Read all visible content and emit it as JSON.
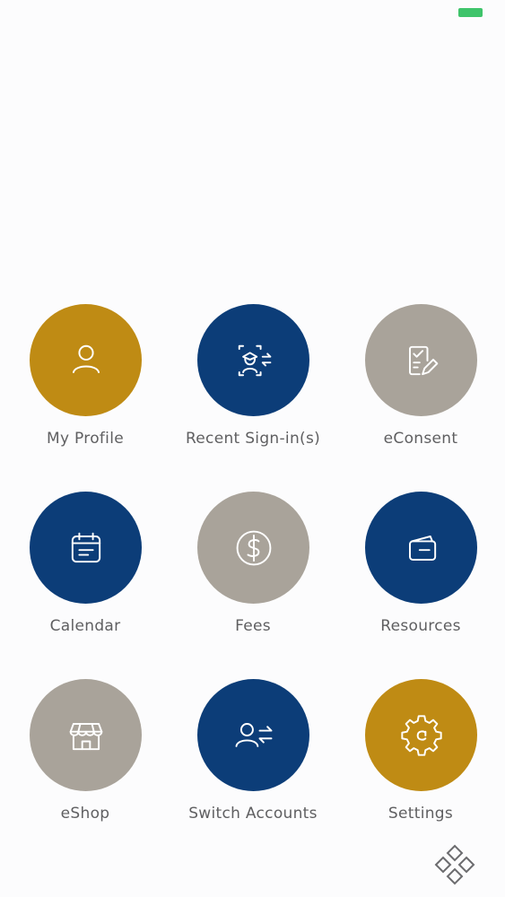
{
  "colors": {
    "gold": "#bf8b14",
    "navy": "#0c3d78",
    "taupe": "#a9a39a",
    "battery": "#3fc46b",
    "label": "#5f5f61"
  },
  "menu": {
    "items": [
      {
        "label": "My Profile",
        "icon": "user-icon",
        "color": "gold"
      },
      {
        "label": "Recent Sign-in(s)",
        "icon": "face-scan-swap-icon",
        "color": "navy"
      },
      {
        "label": "eConsent",
        "icon": "clipboard-edit-icon",
        "color": "taupe"
      },
      {
        "label": "Calendar",
        "icon": "calendar-icon",
        "color": "navy"
      },
      {
        "label": "Fees",
        "icon": "dollar-icon",
        "color": "taupe"
      },
      {
        "label": "Resources",
        "icon": "wallet-icon",
        "color": "navy"
      },
      {
        "label": "eShop",
        "icon": "storefront-icon",
        "color": "taupe"
      },
      {
        "label": "Switch Accounts",
        "icon": "user-switch-icon",
        "color": "navy"
      },
      {
        "label": "Settings",
        "icon": "gear-icon",
        "color": "gold"
      }
    ]
  },
  "footer": {
    "logo_icon": "diamond-logo-icon"
  }
}
